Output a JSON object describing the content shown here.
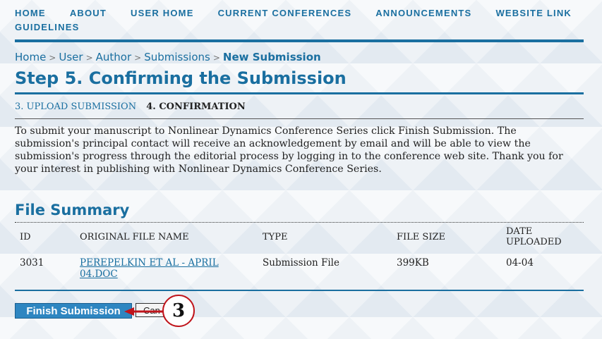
{
  "nav": {
    "items": [
      "HOME",
      "ABOUT",
      "USER HOME",
      "CURRENT CONFERENCES",
      "ANNOUNCEMENTS",
      "WEBSITE LINK",
      "GUIDELINES"
    ]
  },
  "breadcrumb": {
    "items": [
      "Home",
      "User",
      "Author",
      "Submissions"
    ],
    "separator": ">",
    "current": "New Submission"
  },
  "page_title": "Step 5. Confirming the Submission",
  "steps": {
    "previous": "3. UPLOAD SUBMISSION",
    "current": "4. CONFIRMATION"
  },
  "intro_text": "To submit your manuscript to Nonlinear Dynamics Conference Series click Finish Submission. The submission's principal contact will receive an acknowledgement by email and will be able to view the submission's progress through the editorial process by logging in to the conference web site. Thank you for your interest in publishing with Nonlinear Dynamics Conference Series.",
  "file_summary": {
    "heading": "File Summary",
    "columns": [
      "ID",
      "ORIGINAL FILE NAME",
      "TYPE",
      "FILE SIZE",
      "DATE UPLOADED"
    ],
    "rows": [
      {
        "id": "3031",
        "file_name": "PEREPELKIN ET AL - APRIL 04.DOC",
        "type": "Submission File",
        "size": "399KB",
        "date": "04-04"
      }
    ]
  },
  "buttons": {
    "finish": "Finish Submission",
    "cancel": "Can"
  },
  "callout": {
    "number": "3",
    "color": "#c0141b"
  },
  "colors": {
    "accent": "#1a6fa0",
    "button": "#2e86c1"
  }
}
